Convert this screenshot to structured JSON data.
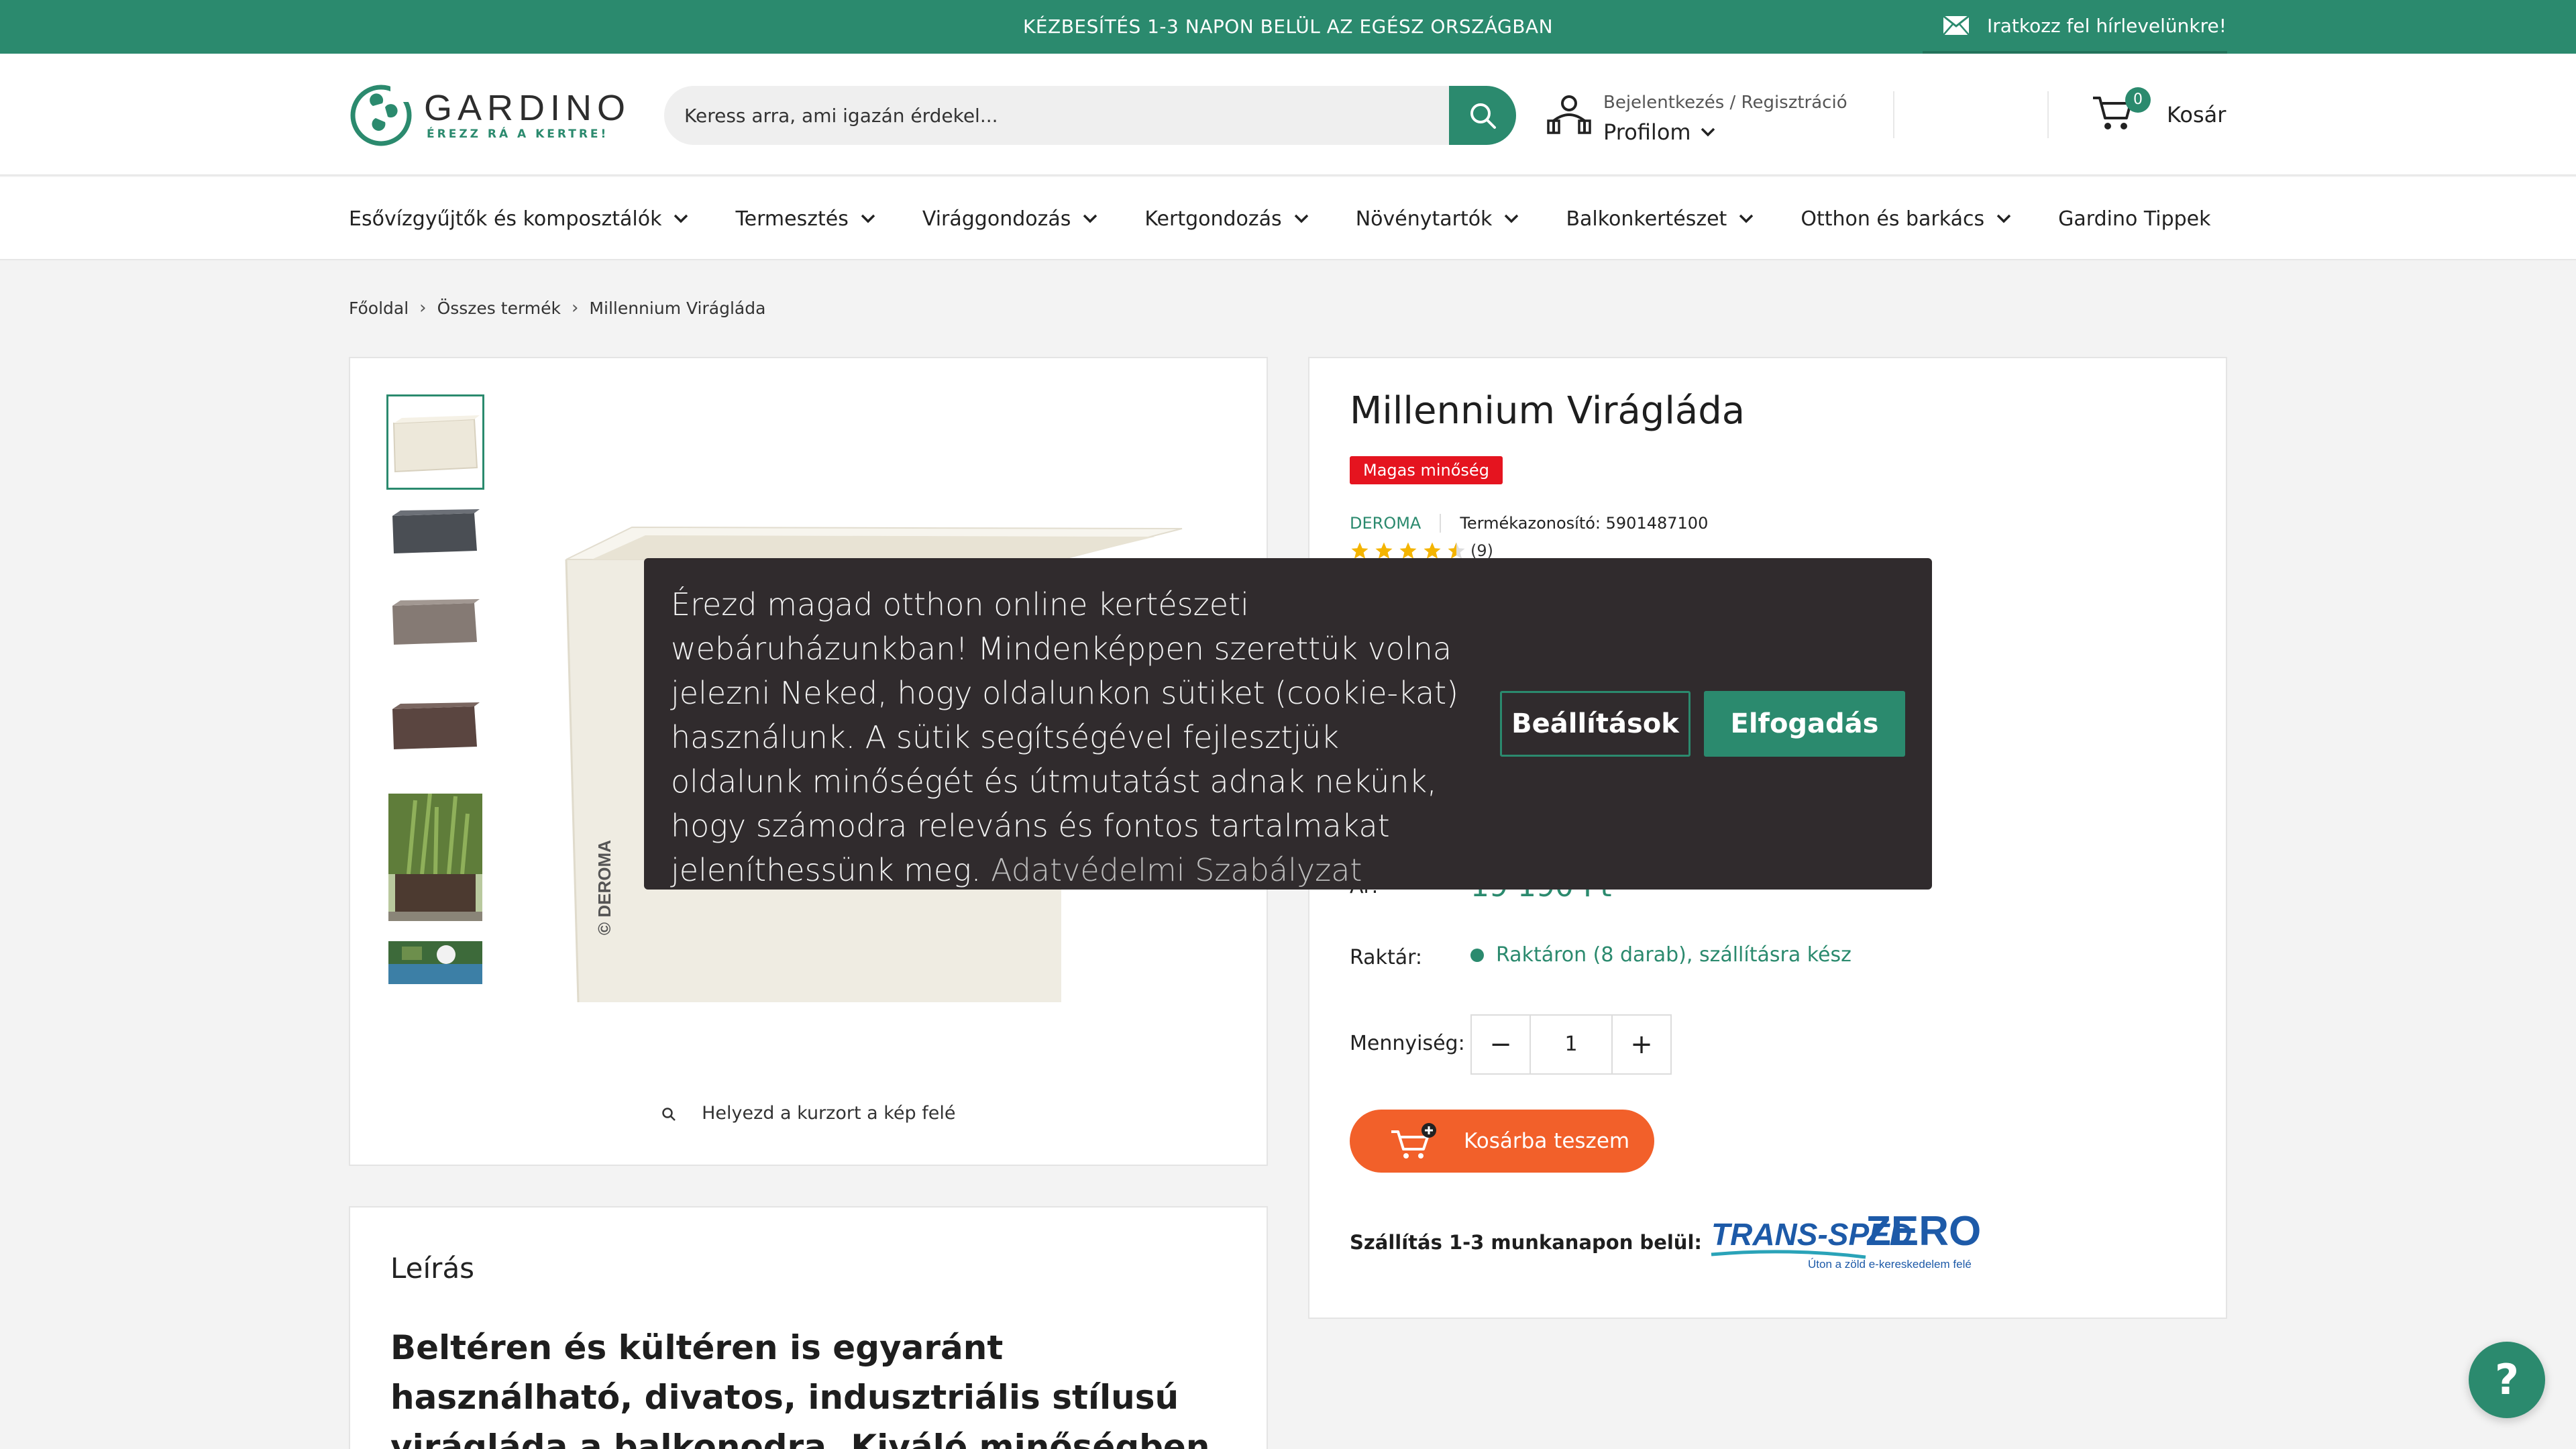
{
  "topbar": {
    "announcement": "KÉZBESÍTÉS 1-3 NAPON BELÜL AZ EGÉSZ ORSZÁGBAN",
    "newsletter": "Iratkozz fel hírlevelünkre!"
  },
  "header": {
    "logo_word": "GARDINO",
    "logo_tagline": "ÉREZZ RÁ A KERTRE!",
    "search_placeholder": "Keress arra, ami igazán érdekel...",
    "account_line1": "Bejelentkezés / Regisztráció",
    "account_line2": "Profilom",
    "cart_count": "0",
    "cart_label": "Kosár"
  },
  "nav": {
    "items": [
      {
        "label": "Esővízgyűjtők és komposztálók"
      },
      {
        "label": "Termesztés"
      },
      {
        "label": "Virággondozás"
      },
      {
        "label": "Kertgondozás"
      },
      {
        "label": "Növénytartók"
      },
      {
        "label": "Balkonkertészet"
      },
      {
        "label": "Otthon és barkács"
      },
      {
        "label": "Gardino Tippek"
      }
    ]
  },
  "breadcrumb": [
    "Főoldal",
    "Összes termék",
    "Millennium Virágláda"
  ],
  "gallery": {
    "zoom_hint": "Helyezd a kurzort a kép felé",
    "watermark": "© DEROMA"
  },
  "product": {
    "name": "Millennium Virágláda",
    "badge": "Magas minőség",
    "brand": "DEROMA",
    "sku_label": "Termékazonosító:",
    "sku": "5901487100",
    "rating_value": 4.5,
    "rating_count": "(9)",
    "price_label": "Ár:",
    "price": "19 190 Ft",
    "stock_label": "Raktár:",
    "stock_text": "Raktáron (8 darab), szállításra kész",
    "qty_label": "Mennyiség:",
    "qty_value": "1",
    "qty_minus": "−",
    "qty_plus": "+",
    "add_to_cart": "Kosárba teszem",
    "shipping_text": "Szállítás 1-3 munkanapon belül:",
    "shipping_logo_left": "TRANS-SPED",
    "shipping_logo_right": "ZERO",
    "shipping_logo_tagline": "Úton a zöld e-kereskedelem felé"
  },
  "description": {
    "title": "Leírás",
    "body": "Beltéren és kültéren is egyaránt használható, divatos, indusztriális stílusú virágláda a balkonodra. Kiváló minőségben az olasz Deroma"
  },
  "cookie": {
    "text": "Érezd magad otthon online kertészeti webáruházunkban! Mindenképpen szerettük volna jelezni Neked, hogy oldalunkon sütiket (cookie-kat) használunk. A sütik segítségével fejlesztjük oldalunk minőségét és útmutatást adnak nekünk, hogy számodra releváns és fontos tartalmakat jeleníthessünk meg.",
    "link": "Adatvédelmi Szabályzat",
    "settings": "Beállítások",
    "accept": "Elfogadás"
  },
  "help": {
    "label": "?"
  },
  "colors": {
    "brand": "#2b8a6e",
    "accent": "#f2602a",
    "badge": "#e5141f",
    "cookie_bg": "#302b2d"
  }
}
